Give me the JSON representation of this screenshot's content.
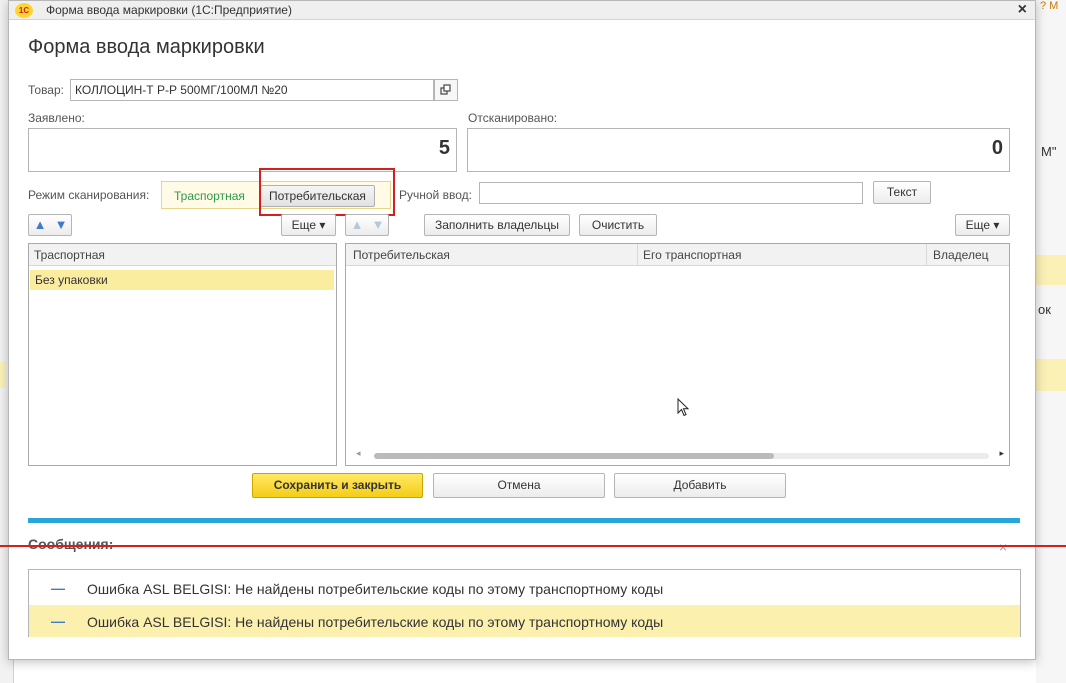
{
  "window": {
    "title": "Форма ввода маркировки  (1С:Предприятие)",
    "logo_text": "1С",
    "close": "×"
  },
  "form": {
    "heading": "Форма ввода маркировки",
    "product_label": "Товар:",
    "product_value": "КОЛЛОЦИН-Т Р-Р 500МГ/100МЛ №20",
    "declared_label": "Заявлено:",
    "declared_value": "5",
    "scanned_label": "Отсканировано:",
    "scanned_value": "0",
    "scan_mode_label": "Режим сканирования:",
    "scan_mode_options": [
      "Траспортная",
      "Потребительская"
    ],
    "manual_input_label": "Ручной ввод:",
    "manual_input_value": "",
    "text_button": "Текст"
  },
  "left_table": {
    "more_button": "Еще ▾",
    "column_header": "Траспортная",
    "rows": [
      "Без упаковки"
    ]
  },
  "right_table": {
    "fill_owners_button": "Заполнить владельцы",
    "clear_button": "Очистить",
    "more_button": "Еще ▾",
    "columns": [
      "Потребительская",
      "Его транспортная",
      "Владелец"
    ]
  },
  "footer_buttons": {
    "save_close": "Сохранить и закрыть",
    "cancel": "Отмена",
    "add": "Добавить"
  },
  "messages": {
    "title": "Сообщения:",
    "close": "×",
    "items": [
      "Ошибка ASL BELGISI: Не найдены потребительские коды по этому транспортному коды",
      "Ошибка ASL BELGISI: Не найдены потребительские коды по этому транспортному коды"
    ]
  },
  "background": {
    "right_fragments": [
      "M\"",
      "ок"
    ],
    "top_right": "? M"
  },
  "colors": {
    "accent_yellow": "#f5cd17",
    "selection": "#fbeda0",
    "blue_bar": "#28a6dc",
    "highlight_red": "#d41f1f",
    "mode_green": "#2e9a4a"
  }
}
